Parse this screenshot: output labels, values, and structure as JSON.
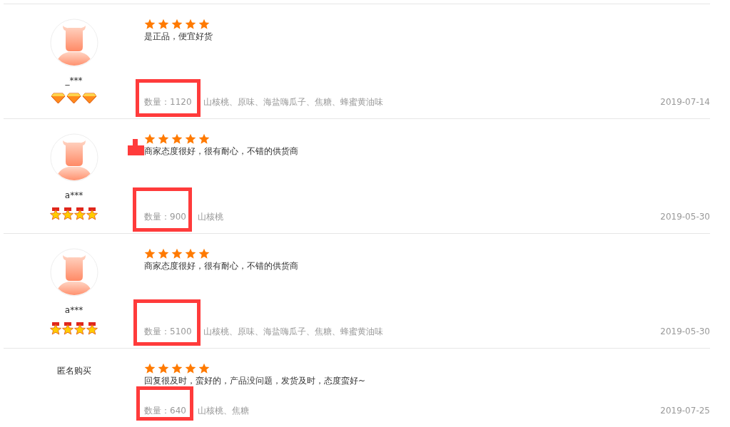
{
  "reviews": [
    {
      "avatar": true,
      "user": "_***",
      "badges": [
        {
          "kind": "diamond"
        },
        {
          "kind": "diamond"
        },
        {
          "kind": "diamond"
        }
      ],
      "stars": 5,
      "marked": false,
      "comment": "是正品，便宜好货",
      "quantity": "数量：1120",
      "spec": "山核桃、原味、海盐嗨瓜子、焦糖、蜂蜜黄油味",
      "date": "2019-07-14"
    },
    {
      "avatar": true,
      "user": "a***",
      "badges": [
        {
          "kind": "medal"
        },
        {
          "kind": "medal"
        },
        {
          "kind": "medal"
        },
        {
          "kind": "medal"
        }
      ],
      "stars": 5,
      "marked": true,
      "comment": "商家态度很好，很有耐心，不错的供货商",
      "quantity": "数量：900",
      "spec": "山核桃",
      "date": "2019-05-30"
    },
    {
      "avatar": true,
      "user": "a***",
      "badges": [
        {
          "kind": "medal"
        },
        {
          "kind": "medal"
        },
        {
          "kind": "medal"
        },
        {
          "kind": "medal"
        }
      ],
      "stars": 5,
      "marked": false,
      "comment": "商家态度很好，很有耐心，不错的供货商",
      "quantity": "数量：5100",
      "spec": "山核桃、原味、海盐嗨瓜子、焦糖、蜂蜜黄油味",
      "date": "2019-05-30"
    },
    {
      "avatar": false,
      "user": "匿名购买",
      "stars": 5,
      "marked": false,
      "comment": "回复很及时，蛮好的，产品没问题，发货及时，态度蛮好~",
      "quantity": "数量：640",
      "spec": "山核桃、焦糖",
      "date": "2019-07-25"
    }
  ]
}
